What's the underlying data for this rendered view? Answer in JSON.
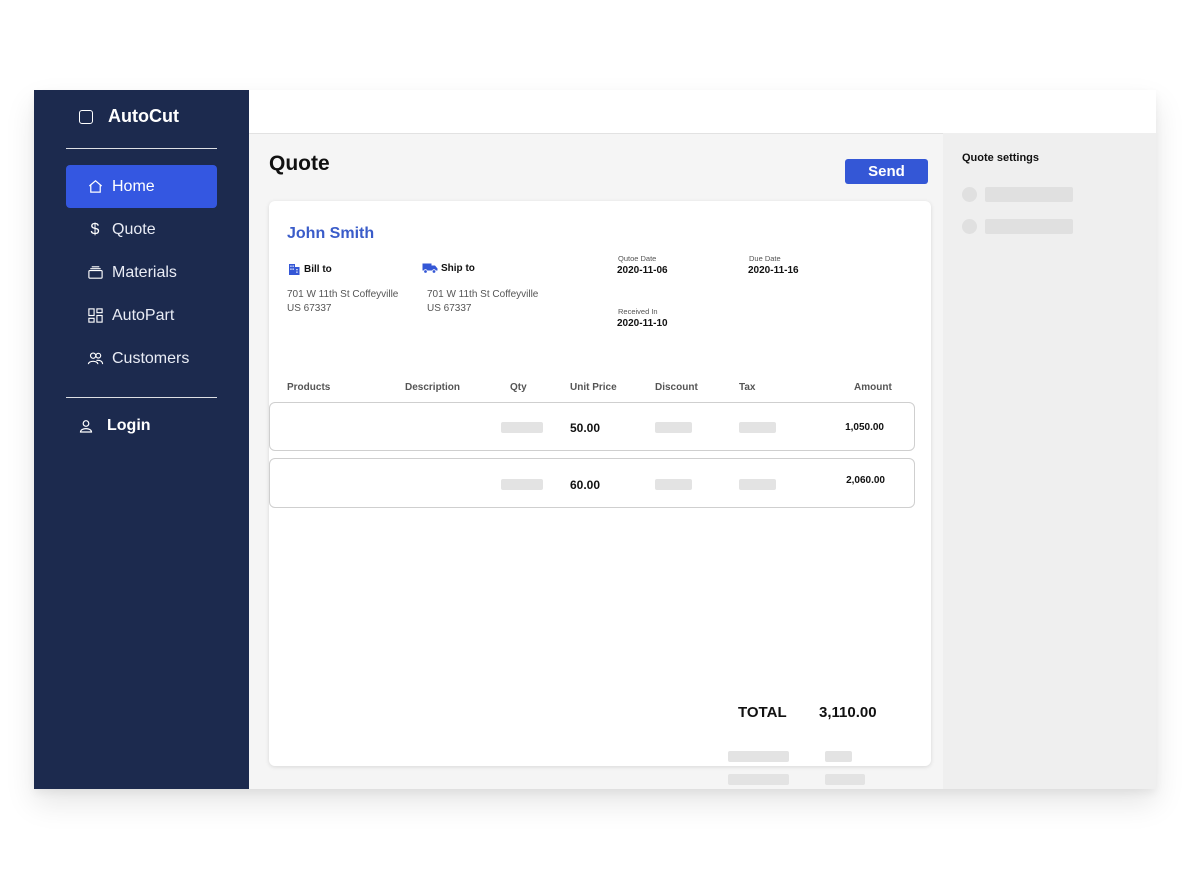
{
  "app": {
    "name": "AutoCut"
  },
  "sidebar": {
    "items": [
      {
        "label": "Home",
        "icon": "home-icon",
        "active": true
      },
      {
        "label": "Quote",
        "icon": "dollar-icon",
        "active": false
      },
      {
        "label": "Materials",
        "icon": "layers-icon",
        "active": false
      },
      {
        "label": "AutoPart",
        "icon": "grid-icon",
        "active": false
      },
      {
        "label": "Customers",
        "icon": "users-icon",
        "active": false
      }
    ],
    "login_label": "Login"
  },
  "main": {
    "title": "Quote",
    "send_label": "Send"
  },
  "quote": {
    "customer_name": "John Smith",
    "bill_to": {
      "label": "Bill to",
      "line1": "701 W 11th St Coffeyville",
      "line2": "US 67337"
    },
    "ship_to": {
      "label": "Ship to",
      "line1": "701 W 11th St Coffeyville",
      "line2": "US 67337"
    },
    "quote_date": {
      "label": "Qutoe Date",
      "value": "2020-11-06"
    },
    "due_date": {
      "label": "Due Date",
      "value": "2020-11-16"
    },
    "received_in": {
      "label": "Received In",
      "value": "2020-11-10"
    },
    "columns": [
      "Products",
      "Description",
      "Qty",
      "Unit Price",
      "Discount",
      "Tax",
      "Amount"
    ],
    "rows": [
      {
        "unit_price": "50.00",
        "amount": "1,050.00"
      },
      {
        "unit_price": "60.00",
        "amount": "2,060.00"
      }
    ],
    "total_label": "TOTAL",
    "total_value": "3,110.00"
  },
  "settings": {
    "title": "Quote settings"
  },
  "colors": {
    "sidebar": "#1c2a4e",
    "accent": "#3457e1",
    "customer": "#3a5cc9"
  }
}
